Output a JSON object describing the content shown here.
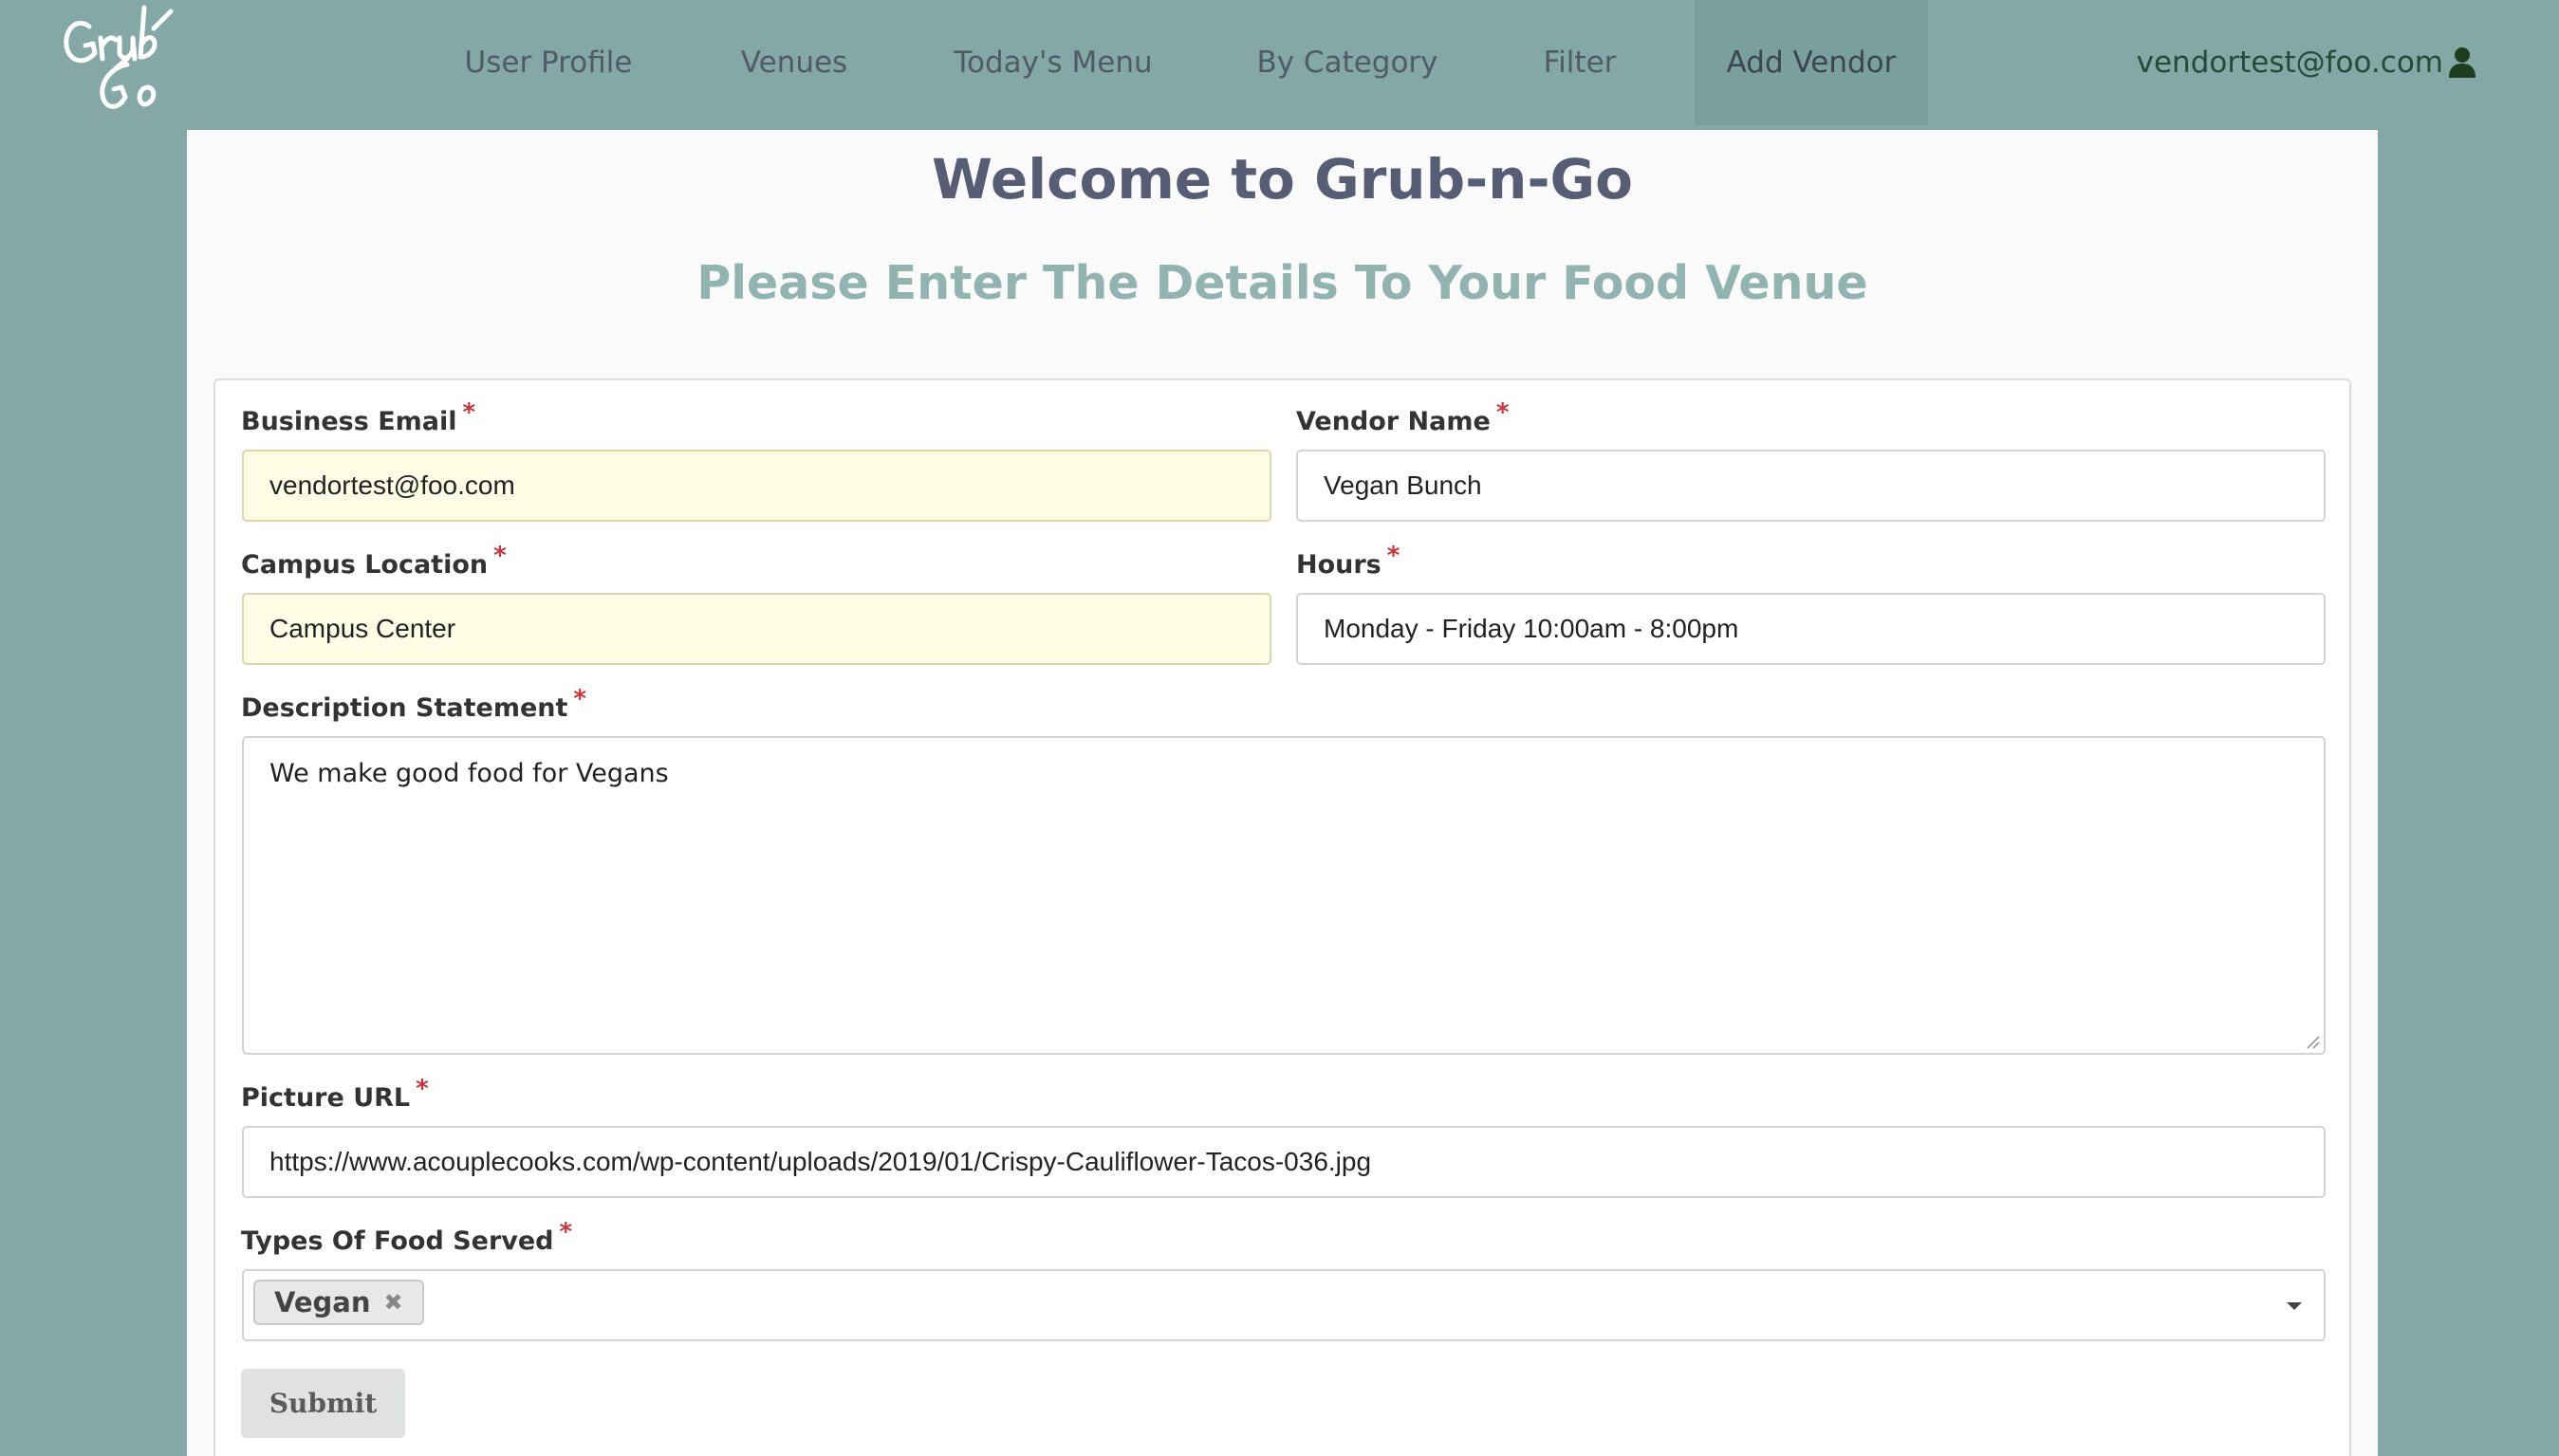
{
  "nav": {
    "items": [
      {
        "label": "User Profile"
      },
      {
        "label": "Venues"
      },
      {
        "label": "Today's Menu"
      },
      {
        "label": "By Category"
      },
      {
        "label": "Filter"
      },
      {
        "label": "Add Vendor"
      }
    ],
    "active": "Add Vendor",
    "user_email": "vendortest@foo.com",
    "user_icon": "user-icon"
  },
  "header": {
    "title": "Welcome to Grub-n-Go",
    "subtitle": "Please Enter The Details To Your Food Venue"
  },
  "form": {
    "business_email": {
      "label": "Business Email",
      "value": "vendortest@foo.com"
    },
    "vendor_name": {
      "label": "Vendor Name",
      "value": "Vegan Bunch"
    },
    "campus_location": {
      "label": "Campus Location",
      "value": "Campus Center"
    },
    "hours": {
      "label": "Hours",
      "value": "Monday - Friday 10:00am - 8:00pm"
    },
    "description": {
      "label": "Description Statement",
      "value": "We make good food for Vegans"
    },
    "picture_url": {
      "label": "Picture URL",
      "value": "https://www.acouplecooks.com/wp-content/uploads/2019/01/Crispy-Cauliflower-Tacos-036.jpg"
    },
    "food_types": {
      "label": "Types Of Food Served",
      "selected": [
        "Vegan"
      ]
    },
    "required_mark": "*",
    "remove_glyph": "✖",
    "submit_label": "Submit"
  },
  "colors": {
    "nav_bg": "#83a8a6",
    "title": "#565d74",
    "subtitle": "#92b4b1",
    "required": "#d2323a"
  }
}
